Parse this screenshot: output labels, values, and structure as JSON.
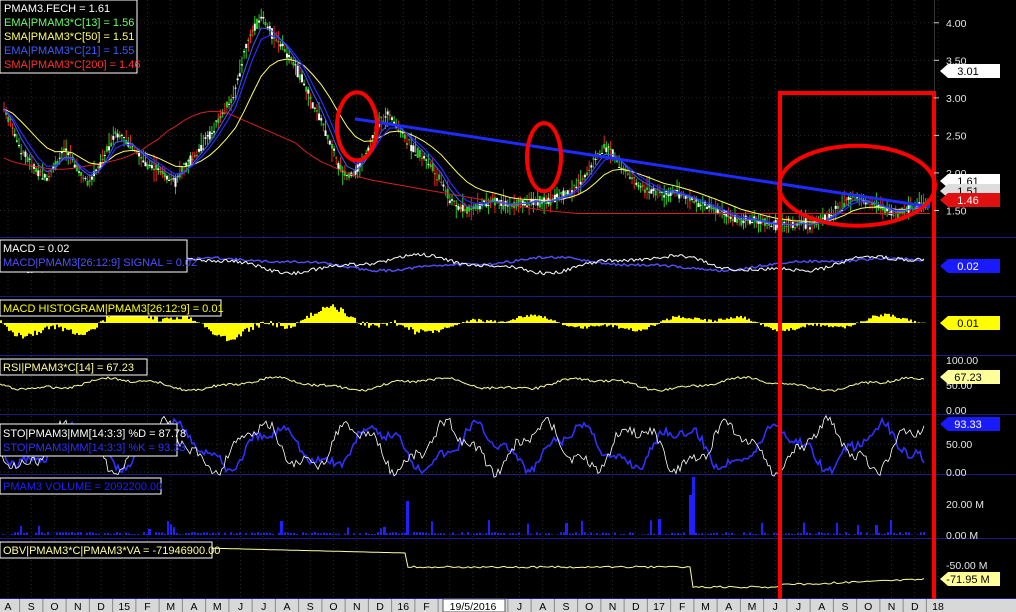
{
  "chart_data": {
    "type": "line",
    "symbol": "PMAM3",
    "cursor_date": "19/5/2016",
    "months": [
      "A",
      "S",
      "O",
      "N",
      "D",
      "15",
      "F",
      "M",
      "A",
      "M",
      "J",
      "J",
      "A",
      "S",
      "O",
      "N",
      "D",
      "16",
      "F",
      "M",
      "",
      "J",
      "J",
      "A",
      "S",
      "O",
      "N",
      "D",
      "17",
      "F",
      "M",
      "A",
      "M",
      "J",
      "J",
      "A",
      "S",
      "O",
      "N",
      "D",
      "18"
    ],
    "colors": {
      "price": "#ffffff",
      "ema13": "#3b5cff",
      "sma50": "#ffff66",
      "ema21": "#2a2aff",
      "sma200": "#d62020",
      "trend": "#1d2bff",
      "annot": "#ff0000",
      "macd": "#ffffff",
      "signal": "#5050ff",
      "hist": "#ffff00",
      "rsi": "#ffff99",
      "stoK": "#ffffff",
      "stoD": "#3030ff",
      "volume": "#2020ff",
      "obv": "#ffff99"
    },
    "panels": [
      {
        "id": "price",
        "legend": [
          {
            "text": "PMAM3.FECH = 1.61",
            "color": "#ffffff"
          },
          {
            "text": "EMA|PMAM3*C[13] = 1.56",
            "color": "#66ff66"
          },
          {
            "text": "SMA|PMAM3*C[50] = 1.51",
            "color": "#ffff66"
          },
          {
            "text": "EMA|PMAM3*C[21] = 1.55",
            "color": "#3b5cff"
          },
          {
            "text": "SMA|PMAM3*C[200] = 1.46",
            "color": "#ff3030"
          }
        ],
        "yticks": [
          "4.00",
          "3.50",
          "3.00",
          "2.50",
          "2.00",
          "1.50"
        ],
        "markers": [
          {
            "text": "3.01",
            "bg": "#ffffff",
            "fg": "#000000"
          },
          {
            "text": "1.61",
            "bg": "#ffffff",
            "fg": "#000000"
          },
          {
            "text": "1.51",
            "bg": "#dddddd",
            "fg": "#000000"
          },
          {
            "text": "1.46",
            "bg": "#e01010",
            "fg": "#ffffff"
          }
        ],
        "price": [
          2.85,
          2.6,
          2.3,
          2.15,
          2.0,
          1.95,
          2.1,
          2.3,
          2.2,
          1.95,
          1.9,
          2.05,
          2.3,
          2.55,
          2.45,
          2.35,
          2.2,
          2.1,
          2.05,
          1.95,
          1.9,
          2.05,
          2.2,
          2.35,
          2.5,
          2.7,
          2.9,
          3.1,
          3.6,
          3.9,
          4.1,
          3.9,
          3.75,
          3.6,
          3.4,
          3.2,
          2.9,
          2.7,
          2.4,
          2.1,
          1.95,
          2.0,
          2.2,
          2.45,
          2.7,
          2.75,
          2.6,
          2.45,
          2.3,
          2.2,
          2.05,
          1.9,
          1.65,
          1.55,
          1.5,
          1.55,
          1.6,
          1.65,
          1.6,
          1.55,
          1.6,
          1.6,
          1.65,
          1.6,
          1.65,
          1.7,
          1.75,
          1.85,
          2.0,
          2.2,
          2.35,
          2.25,
          2.1,
          1.95,
          1.85,
          1.8,
          1.75,
          1.7,
          1.75,
          1.7,
          1.65,
          1.6,
          1.55,
          1.5,
          1.45,
          1.4,
          1.35,
          1.38,
          1.35,
          1.32,
          1.3,
          1.32,
          1.3,
          1.35,
          1.3,
          1.35,
          1.4,
          1.5,
          1.6,
          1.7,
          1.65,
          1.6,
          1.55,
          1.5,
          1.45,
          1.5,
          1.55,
          1.58,
          1.61
        ],
        "sma200": [
          2.2,
          2.15,
          2.12,
          2.1,
          2.08,
          2.06,
          2.05,
          2.05,
          2.06,
          2.08,
          2.1,
          2.12,
          2.14,
          2.17,
          2.2,
          2.25,
          2.3,
          2.38,
          2.45,
          2.55,
          2.62,
          2.7,
          2.76,
          2.8,
          2.82,
          2.82,
          2.8,
          2.75,
          2.7,
          2.65,
          2.6,
          2.55,
          2.5,
          2.45,
          2.4,
          2.3,
          2.22,
          2.15,
          2.1,
          2.05,
          2.0,
          1.96,
          1.93,
          1.9,
          1.88,
          1.86,
          1.84,
          1.82,
          1.8,
          1.78,
          1.76,
          1.74,
          1.72,
          1.7,
          1.68,
          1.66,
          1.64,
          1.62,
          1.6,
          1.58,
          1.56,
          1.54,
          1.52,
          1.5,
          1.49,
          1.48,
          1.47,
          1.46,
          1.46,
          1.46,
          1.46,
          1.46,
          1.46,
          1.46,
          1.46,
          1.46,
          1.46,
          1.46,
          1.46,
          1.46,
          1.46,
          1.46,
          1.46,
          1.46,
          1.46,
          1.46,
          1.46,
          1.46,
          1.46,
          1.46,
          1.46,
          1.46,
          1.46,
          1.46,
          1.46,
          1.46,
          1.46,
          1.46,
          1.46,
          1.46,
          1.46,
          1.46,
          1.46,
          1.46,
          1.46,
          1.46,
          1.46,
          1.46,
          1.46
        ],
        "trend": [
          {
            "x": 355,
            "y": 2.72
          },
          {
            "x": 930,
            "y": 1.55
          }
        ],
        "ellipses": [
          {
            "cx": 357,
            "cy": 2.62,
            "rx": 20,
            "ry": 34
          },
          {
            "cx": 544,
            "cy": 2.21,
            "rx": 17,
            "ry": 34
          },
          {
            "cx": 857,
            "cy": 1.83,
            "rx": 78,
            "ry": 40
          }
        ],
        "box": {
          "x1": 780,
          "x2": 934
        }
      },
      {
        "id": "macd",
        "legend": [
          {
            "text": "MACD = 0.02",
            "color": "#ffffff"
          },
          {
            "text": "MACD|PMAM3[26:12:9] SIGNAL = 0.02",
            "color": "#5050ff"
          }
        ],
        "markers": [
          {
            "text": "0.02",
            "bg": "#1a1aff",
            "fg": "#ffffff"
          }
        ]
      },
      {
        "id": "macdhist",
        "legend": [
          {
            "text": "MACD HISTOGRAM|PMAM3[26:12:9] = 0.01",
            "color": "#ffff00"
          }
        ],
        "markers": [
          {
            "text": "0.01",
            "bg": "#ffff00",
            "fg": "#000000"
          }
        ]
      },
      {
        "id": "rsi",
        "legend": [
          {
            "text": "RSI|PMAM3*C[14] = 67.23",
            "color": "#ffff99"
          }
        ],
        "yticks": [
          "100.00",
          "50.00",
          "0.00"
        ],
        "markers": [
          {
            "text": "67.23",
            "bg": "#ffff99",
            "fg": "#000000"
          }
        ]
      },
      {
        "id": "sto",
        "legend": [
          {
            "text": "STO|PMAM3|MM[14:3:3] %D = 87.78",
            "color": "#ffffff"
          },
          {
            "text": "STO|PMAM3|MM[14:3:3] %K = 93.33",
            "color": "#3030ff"
          }
        ],
        "yticks": [
          "50.00",
          "0.00"
        ],
        "markers": [
          {
            "text": "93.33",
            "bg": "#1a1aff",
            "fg": "#ffffff"
          }
        ]
      },
      {
        "id": "volume",
        "legend": [
          {
            "text": "PMAM3 VOLUME = 2092200.00",
            "color": "#2020ff"
          }
        ],
        "yticks": [
          "20.00 M",
          "0.00 M"
        ]
      },
      {
        "id": "obv",
        "legend": [
          {
            "text": "OBV|PMAM3*C|PMAM3*VA = -71946900.00",
            "color": "#ffff99"
          }
        ],
        "yticks": [
          "-50.00 M"
        ],
        "markers": [
          {
            "text": "-71.95 M",
            "bg": "#ffff99",
            "fg": "#000000"
          }
        ]
      }
    ]
  }
}
